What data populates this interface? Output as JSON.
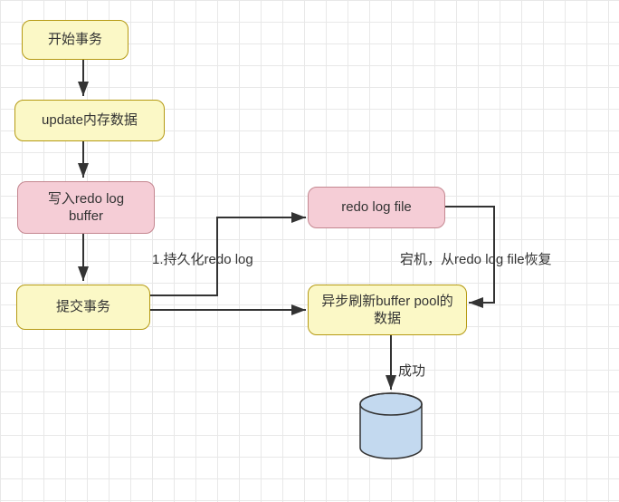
{
  "nodes": {
    "start": "开始事务",
    "update": "update内存数据",
    "redobuf": "写入redo log\nbuffer",
    "commit": "提交事务",
    "redofile": "redo log file",
    "asyncflush": "异步刷新buffer pool的数据"
  },
  "labels": {
    "persist": "1.持久化redo log",
    "recover": "宕机，从redo log file恢复",
    "success": "成功"
  }
}
